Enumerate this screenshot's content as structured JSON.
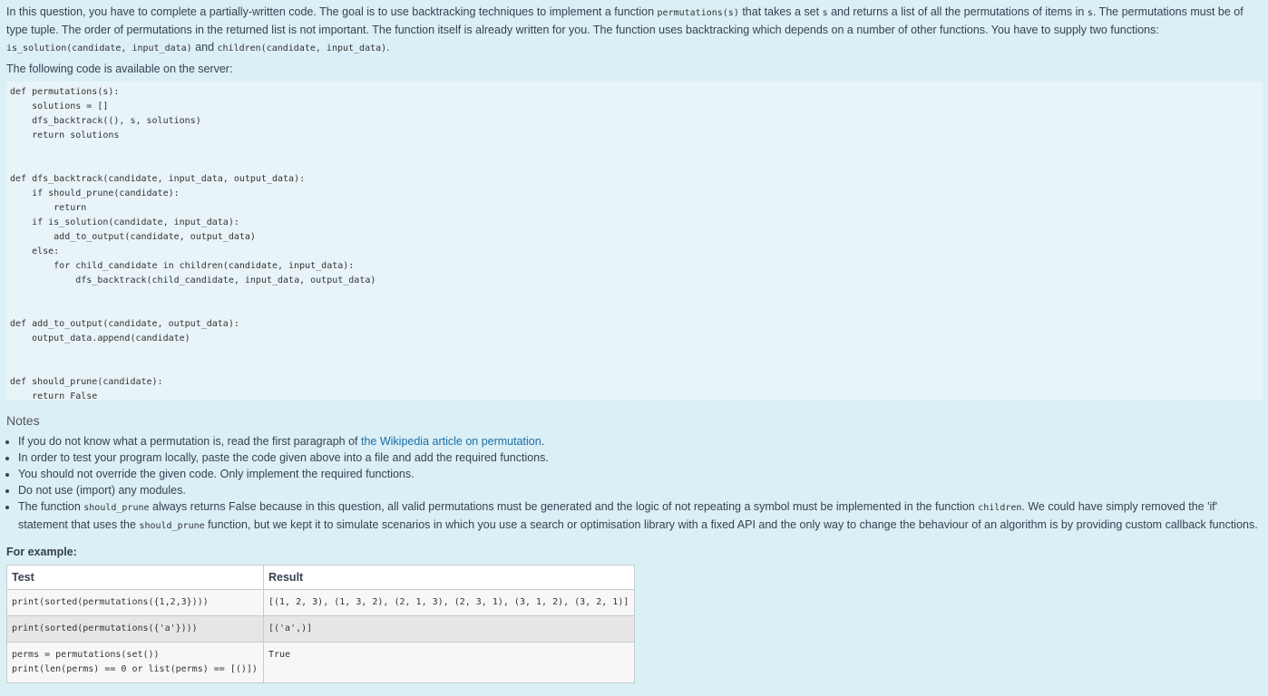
{
  "intro": {
    "t1": "In this question, you have to complete a partially-written code. The goal is to use backtracking techniques to implement a function ",
    "c1": "permutations(s)",
    "t2": " that takes a set ",
    "c2": "s",
    "t3": " and returns a list of all the permutations of items in ",
    "c3": "s",
    "t4": ". The permutations must be of type tuple. The order of permutations in the returned list is not important. The function itself is already written for you. The function uses backtracking which depends on a number of other functions. You have to supply two functions: ",
    "c4": "is_solution(candidate, input_data)",
    "t5": " and ",
    "c5": "children(candidate, input_data)",
    "t6": "."
  },
  "available_label": "The following code is available on the server:",
  "code": "def permutations(s):\n    solutions = []\n    dfs_backtrack((), s, solutions)\n    return solutions\n\n\ndef dfs_backtrack(candidate, input_data, output_data):\n    if should_prune(candidate):\n        return\n    if is_solution(candidate, input_data):\n        add_to_output(candidate, output_data)\n    else:\n        for child_candidate in children(candidate, input_data):\n            dfs_backtrack(child_candidate, input_data, output_data)\n\n\ndef add_to_output(candidate, output_data):\n    output_data.append(candidate)\n\n\ndef should_prune(candidate):\n    return False",
  "notes": {
    "heading": "Notes",
    "n1_pre": "If you do not know what a permutation is, read the first paragraph of ",
    "n1_link": "the Wikipedia article on permutation",
    "n1_post": ".",
    "n2": "In order to test your program locally, paste the code given above into a file and add the required functions.",
    "n3": "You should not override the given code. Only implement the required functions.",
    "n4": "Do not use (import) any modules.",
    "n5_a": "The function ",
    "n5_c1": "should_prune",
    "n5_b": " always returns False because in this question, all valid permutations must be generated and the logic of not repeating a symbol must be implemented in the function ",
    "n5_c2": "children",
    "n5_c": ". We could have simply removed the 'if' statement that uses the ",
    "n5_c3": "should_prune",
    "n5_d": " function, but we kept it to simulate scenarios in which you use a search or optimisation library with a fixed API and the only way to change the behaviour of an algorithm is by providing custom callback functions."
  },
  "example": {
    "label": "For example:",
    "headers": {
      "test": "Test",
      "result": "Result"
    },
    "rows": [
      {
        "test": "print(sorted(permutations({1,2,3})))",
        "result": "[(1, 2, 3), (1, 3, 2), (2, 1, 3), (2, 3, 1), (3, 1, 2), (3, 2, 1)]"
      },
      {
        "test": "print(sorted(permutations({'a'})))",
        "result": "[('a',)]"
      },
      {
        "test": "perms = permutations(set())\nprint(len(perms) == 0 or list(perms) == [()])",
        "result": "True"
      }
    ]
  }
}
